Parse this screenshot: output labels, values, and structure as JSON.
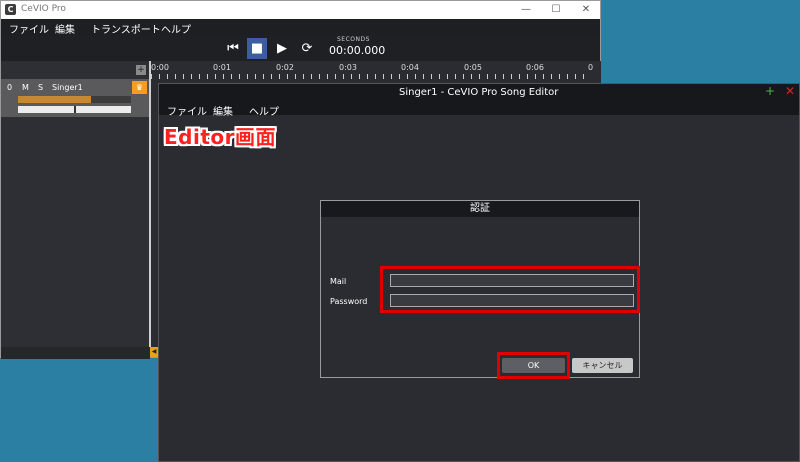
{
  "main_window": {
    "app_icon": "C",
    "title": "CeVIO Pro",
    "controls": {
      "minimize": "—",
      "maximize": "☐",
      "close": "✕"
    },
    "menu": [
      "ファイル",
      "編集",
      "トランスポート",
      "ヘルプ"
    ],
    "transport": {
      "rewind_icon": "skip-to-start-icon",
      "rewind_glyph": "⏮",
      "stop_glyph": "■",
      "play_glyph": "▶",
      "loop_glyph": "⟳",
      "seconds_label": "SECONDS",
      "time": "00:00.000"
    },
    "add_track_glyph": "+",
    "track": {
      "number": "0",
      "mute": "M",
      "solo": "S",
      "name": "Singer1",
      "icon_glyph": "♛",
      "volume_level": 0.65,
      "pan_position": 0.5
    },
    "timeline_ticks": [
      "0:00",
      "0:01",
      "0:02",
      "0:03",
      "0:04",
      "0:05",
      "0:06",
      "0"
    ],
    "scroll_arrow": "◀"
  },
  "editor_window": {
    "title": "Singer1 - CeVIO Pro Song Editor",
    "add_glyph": "+",
    "close_glyph": "✕",
    "menu": [
      "ファイル",
      "編集",
      "ヘルプ"
    ]
  },
  "annotation": {
    "label": "Editor画面",
    "highlight_color": "#e00000"
  },
  "auth_dialog": {
    "title": "認証",
    "mail_label": "Mail",
    "mail_value": "",
    "password_label": "Password",
    "password_value": "",
    "ok_label": "OK",
    "cancel_label": "キャンセル"
  }
}
